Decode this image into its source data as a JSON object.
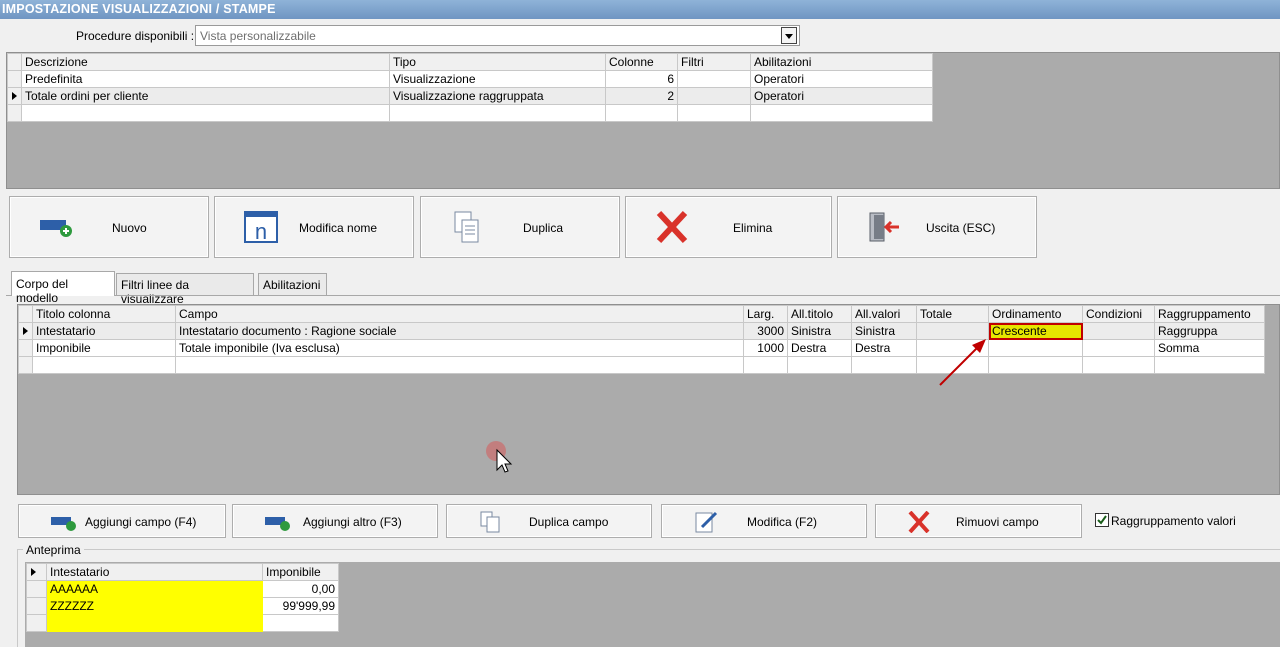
{
  "window": {
    "title": "IMPOSTAZIONE VISUALIZZAZIONI / STAMPE"
  },
  "procedure": {
    "label": "Procedure disponibili :",
    "value": "Vista personalizzabile"
  },
  "views_table": {
    "headers": [
      "Descrizione",
      "Tipo",
      "Colonne",
      "Filtri",
      "Abilitazioni"
    ],
    "rows": [
      [
        "Predefinita",
        "Visualizzazione",
        "6",
        "",
        "Operatori"
      ],
      [
        "Totale ordini per cliente",
        "Visualizzazione raggruppata",
        "2",
        "",
        "Operatori"
      ]
    ]
  },
  "toolbar": {
    "new_label": "Nuovo",
    "rename_label": "Modifica nome",
    "duplicate_label": "Duplica",
    "delete_label": "Elimina",
    "exit_label": "Uscita (ESC)"
  },
  "tabs": [
    "Corpo del modello",
    "Filtri linee da visualizzare",
    "Abilitazioni"
  ],
  "columns_table": {
    "headers": [
      "Titolo colonna",
      "Campo",
      "Larg.",
      "All.titolo",
      "All.valori",
      "Totale",
      "Ordinamento",
      "Condizioni",
      "Raggruppamento"
    ],
    "rows": [
      [
        "Intestatario",
        "Intestatario documento : Ragione sociale",
        "3000",
        "Sinistra",
        "Sinistra",
        "",
        "Crescente",
        "",
        "Raggruppa"
      ],
      [
        "Imponibile",
        "Totale imponibile (Iva esclusa)",
        "1000",
        "Destra",
        "Destra",
        "",
        "",
        "",
        "Somma"
      ]
    ]
  },
  "field_buttons": {
    "add_field_label": "Aggiungi campo (F4)",
    "add_other_label": "Aggiungi altro (F3)",
    "duplicate_field_label": "Duplica campo",
    "edit_label": "Modifica (F2)",
    "remove_field_label": "Rimuovi campo"
  },
  "grouping": {
    "label": "Raggruppamento valori",
    "checked": true
  },
  "preview": {
    "label": "Anteprima",
    "headers": [
      "Intestatario",
      "Imponibile"
    ],
    "rows": [
      [
        "AAAAAA",
        "0,00"
      ],
      [
        "ZZZZZZ",
        "99'999,99"
      ]
    ]
  },
  "colors": {
    "highlight": "#e6e600",
    "highlight_border": "#c00000",
    "preview_yellow": "#ffff00",
    "arrow": "#c00000"
  }
}
